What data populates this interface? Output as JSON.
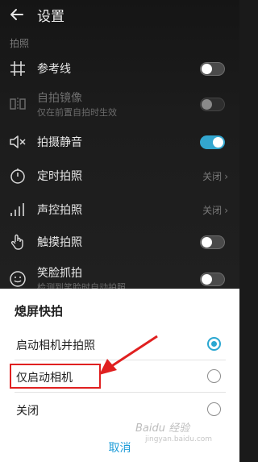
{
  "header": {
    "title": "设置",
    "back_icon": "arrow-left-icon"
  },
  "section_label": "拍照",
  "settings": [
    {
      "label": "参考线",
      "icon": "grid-icon",
      "control": "toggle",
      "state": "off"
    },
    {
      "label": "自拍镜像",
      "sub": "仅在前置自拍时生效",
      "icon": "mirror-icon",
      "control": "toggle",
      "state": "off-disabled"
    },
    {
      "label": "拍摄静音",
      "icon": "mute-speaker-icon",
      "control": "toggle",
      "state": "on"
    },
    {
      "label": "定时拍照",
      "icon": "timer-icon",
      "control": "value",
      "value": "关闭"
    },
    {
      "label": "声控拍照",
      "icon": "sound-bars-icon",
      "control": "value",
      "value": "关闭"
    },
    {
      "label": "触摸拍照",
      "icon": "touch-hand-icon",
      "control": "toggle",
      "state": "off"
    },
    {
      "label": "笑脸抓拍",
      "sub": "检测到笑脸时自动拍照",
      "icon": "smile-icon",
      "control": "toggle",
      "state": "off"
    }
  ],
  "dialog": {
    "title": "熄屏快拍",
    "options": [
      {
        "label": "启动相机并拍照",
        "selected": true
      },
      {
        "label": "仅启动相机",
        "selected": false
      },
      {
        "label": "关闭",
        "selected": false
      }
    ],
    "cancel_label": "取消"
  },
  "colors": {
    "accent": "#2aa7d1",
    "annotation_red": "#e02020"
  },
  "watermark": {
    "text": "Baidu 经验",
    "sub": "jingyan.baidu.com"
  }
}
